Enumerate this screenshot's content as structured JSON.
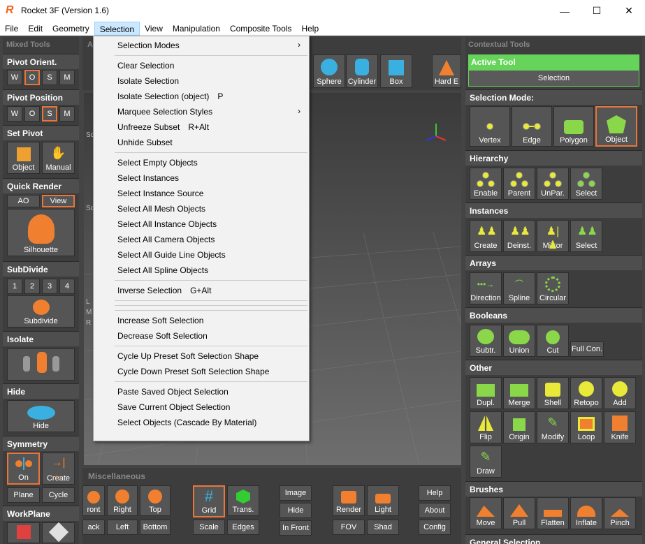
{
  "window": {
    "title": "Rocket 3F (Version 1.6)",
    "logo": "R",
    "minimize": "—",
    "maximize": "☐",
    "close": "✕"
  },
  "menubar": [
    "File",
    "Edit",
    "Geometry",
    "Selection",
    "View",
    "Manipulation",
    "Composite Tools",
    "Help"
  ],
  "left_panel": {
    "header": "Mixed Tools",
    "pivot_orient": {
      "label": "Pivot Orient.",
      "buttons": [
        "W",
        "O",
        "S",
        "M"
      ]
    },
    "pivot_position": {
      "label": "Pivot Position",
      "buttons": [
        "W",
        "O",
        "S",
        "M"
      ]
    },
    "set_pivot": {
      "label": "Set Pivot",
      "object": "Object",
      "manual": "Manual"
    },
    "quick_render": {
      "label": "Quick Render",
      "ao": "AO",
      "view": "View",
      "silhouette": "Silhouette"
    },
    "subdivide": {
      "label": "SubDivide",
      "levels": [
        "1",
        "2",
        "3",
        "4"
      ],
      "button": "Subdivide"
    },
    "isolate": {
      "label": "Isolate"
    },
    "hide": {
      "label": "Hide",
      "button": "Hide"
    },
    "symmetry": {
      "label": "Symmetry",
      "on": "On",
      "create": "Create",
      "plane": "Plane",
      "cycle": "Cycle"
    },
    "workplane": {
      "label": "WorkPlane"
    }
  },
  "top_toolbar": {
    "letter": "A",
    "items": [
      "Sphere",
      "Cylinder",
      "Box",
      "Hard E"
    ]
  },
  "viewport": {
    "left_labels": [
      "Sc",
      "Sc",
      "L",
      "M",
      "R"
    ]
  },
  "misc": {
    "header": "Miscellaneous",
    "row1": [
      "ront",
      "Right",
      "Top",
      "Grid",
      "Trans.",
      "Image",
      "Render",
      "Light",
      "Help"
    ],
    "row1b": [
      "Hide",
      "About"
    ],
    "row2": [
      "ack",
      "Left",
      "Bottom",
      "Scale",
      "Edges",
      "In Front",
      "FOV",
      "Shad",
      "Config"
    ]
  },
  "right_panel": {
    "header": "Contextual Tools",
    "active_tool": "Active Tool",
    "active_value": "Selection",
    "selection_mode": {
      "label": "Selection Mode:",
      "items": [
        "Vertex",
        "Edge",
        "Polygon",
        "Object"
      ]
    },
    "hierarchy": {
      "label": "Hierarchy",
      "items": [
        "Enable",
        "Parent",
        "UnPar.",
        "Select"
      ]
    },
    "instances": {
      "label": "Instances",
      "items": [
        "Create",
        "Deinst.",
        "Mirror",
        "Select"
      ]
    },
    "arrays": {
      "label": "Arrays",
      "items": [
        "Direction",
        "Spline",
        "Circular"
      ]
    },
    "booleans": {
      "label": "Booleans",
      "items": [
        "Subtr.",
        "Union",
        "Cut",
        "Full Con."
      ]
    },
    "other": {
      "label": "Other",
      "row1": [
        "Dupl.",
        "Merge",
        "Shell",
        "Retopo",
        "Add"
      ],
      "row2": [
        "Flip",
        "Origin",
        "Modify",
        "Loop",
        "Knife"
      ],
      "row3": [
        "Draw"
      ]
    },
    "brushes": {
      "label": "Brushes",
      "items": [
        "Move",
        "Pull",
        "Flatten",
        "Inflate",
        "Pinch"
      ]
    },
    "next": "General Selection"
  },
  "selection_menu": [
    {
      "label": "Selection Modes",
      "arrow": "›"
    },
    {
      "sep": true
    },
    {
      "label": "Clear Selection"
    },
    {
      "label": "Isolate Selection"
    },
    {
      "label": "Isolate Selection (object)",
      "shortcut": "P"
    },
    {
      "label": "Marquee Selection Styles",
      "arrow": "›"
    },
    {
      "label": "Unfreeze Subset",
      "shortcut": "R+Alt"
    },
    {
      "label": "Unhide Subset"
    },
    {
      "sep": true
    },
    {
      "label": "Select Empty Objects"
    },
    {
      "label": "Select Instances"
    },
    {
      "label": "Select Instance Source"
    },
    {
      "label": "Select All Mesh Objects"
    },
    {
      "label": "Select All Instance Objects"
    },
    {
      "label": "Select All Camera Objects"
    },
    {
      "label": "Select All Guide Line Objects"
    },
    {
      "label": "Select All Spline Objects"
    },
    {
      "sep": true
    },
    {
      "label": "Inverse Selection",
      "shortcut": "G+Alt"
    },
    {
      "sep": true
    },
    {
      "sep": true
    },
    {
      "sep": true
    },
    {
      "label": "Increase Soft Selection"
    },
    {
      "label": "Decrease Soft Selection"
    },
    {
      "sep": true
    },
    {
      "label": "Cycle Up Preset Soft Selection Shape"
    },
    {
      "label": "Cycle Down Preset Soft Selection Shape"
    },
    {
      "sep": true
    },
    {
      "label": "Paste Saved Object Selection"
    },
    {
      "label": "Save Current Object Selection"
    },
    {
      "label": "Select Objects (Cascade By Material)"
    }
  ],
  "colors": {
    "accent": "#e8763a",
    "active_green": "#66d45a",
    "yellow": "#e9e93a"
  }
}
